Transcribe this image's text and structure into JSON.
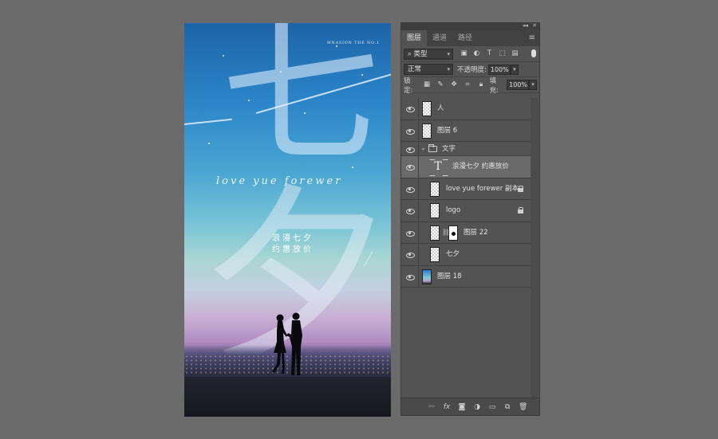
{
  "poster": {
    "brand": "MNASION THE NO.1",
    "char1": "七",
    "char2": "夕",
    "script": "love yue forewer",
    "tagline1": "浪漫七夕",
    "tagline2": "约惠放价"
  },
  "panel": {
    "tabs": [
      "图层",
      "通道",
      "路径"
    ],
    "filter_label": "类型",
    "blend_mode": "正常",
    "opacity_label": "不透明度:",
    "opacity_value": "100%",
    "lock_label": "锁定:",
    "fill_label": "填充:",
    "fill_value": "100%"
  },
  "layers": [
    {
      "name": "人",
      "selected": false
    },
    {
      "name": "图层 6",
      "selected": false
    },
    {
      "name": "文字",
      "group": true
    },
    {
      "name": "浪漫七夕 约惠放价",
      "selected": true,
      "type": "text"
    },
    {
      "name": "love yue forewer 副本",
      "locked": true
    },
    {
      "name": "logo",
      "locked": true
    },
    {
      "name": "图层 22",
      "masked": true
    },
    {
      "name": "七夕"
    },
    {
      "name": "图层 18",
      "type": "image"
    }
  ],
  "bottom_icons": [
    "link-icon",
    "fx-icon",
    "mask-icon",
    "adjustment-icon",
    "folder-icon",
    "new-layer-icon",
    "trash-icon"
  ]
}
